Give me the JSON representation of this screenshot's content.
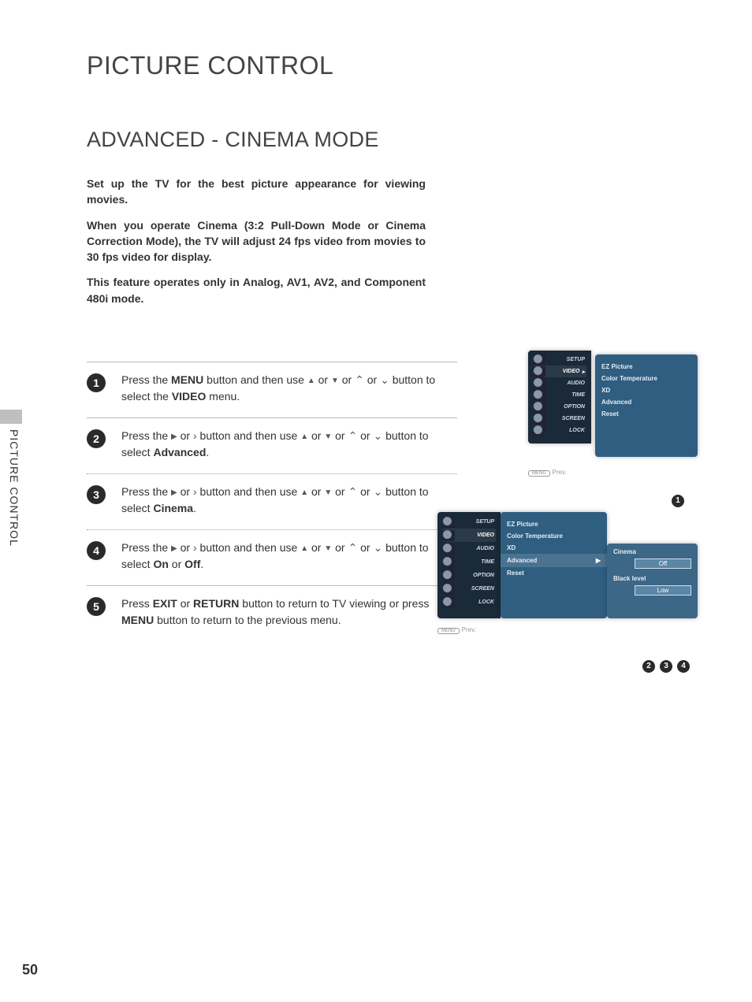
{
  "page_number": "50",
  "side_tab_label": "PICTURE CONTROL",
  "page_title": "PICTURE CONTROL",
  "section_title": "ADVANCED - CINEMA MODE",
  "intro": {
    "p1": "Set up the TV for the best picture appearance for viewing movies.",
    "p2": "When you operate Cinema (3:2 Pull-Down Mode or Cinema Correction Mode), the TV will adjust 24 fps video from movies to 30 fps video for display.",
    "p3": "This feature operates only in Analog, AV1, AV2, and Component 480i mode."
  },
  "steps": {
    "s1_a": "Press the ",
    "s1_menu": "MENU",
    "s1_b": " button and then use ",
    "s1_c": " or ",
    "s1_d": "  or  ",
    "s1_e": " or ",
    "s1_f": "  button to select the ",
    "s1_video": "VIDEO",
    "s1_g": " menu.",
    "s2_a": "Press the ",
    "s2_b": "  or  ",
    "s2_c": "  button and then use ",
    "s2_d": " or ",
    "s2_e": "  or  ",
    "s2_f": " or ",
    "s2_g": "  button to select ",
    "s2_adv": "Advanced",
    "s2_h": ".",
    "s3_a": "Press the ",
    "s3_b": "  or  ",
    "s3_c": "  button and then use ",
    "s3_d": " or ",
    "s3_e": "  or  ",
    "s3_f": " or ",
    "s3_g": "  button to select ",
    "s3_cin": "Cinema",
    "s3_h": ".",
    "s4_a": "Press the ",
    "s4_b": "  or  ",
    "s4_c": "  button and then use ",
    "s4_d": " or ",
    "s4_e": "  or  ",
    "s4_f": " or ",
    "s4_g": "  button to select ",
    "s4_on": "On",
    "s4_mid": " or ",
    "s4_off": "Off",
    "s4_h": ".",
    "s5_a": "Press ",
    "s5_exit": "EXIT",
    "s5_b": " or ",
    "s5_ret": "RETURN",
    "s5_c": " button to return to TV viewing or press ",
    "s5_menu": "MENU",
    "s5_d": " button to return to the previous menu."
  },
  "osd": {
    "side_items": [
      "SETUP",
      "VIDEO",
      "AUDIO",
      "TIME",
      "OPTION",
      "SCREEN",
      "LOCK"
    ],
    "video_items": [
      "EZ Picture",
      "Color Temperature",
      "XD",
      "Advanced",
      "Reset"
    ],
    "advanced_sub": {
      "cinema_label": "Cinema",
      "cinema_value": "Off",
      "black_label": "Black level",
      "black_value": "Low"
    },
    "foot_btn": "MENU",
    "foot_text": "Prev."
  },
  "callouts": {
    "c1": "1",
    "c2": "2",
    "c3": "3",
    "c4": "4"
  }
}
